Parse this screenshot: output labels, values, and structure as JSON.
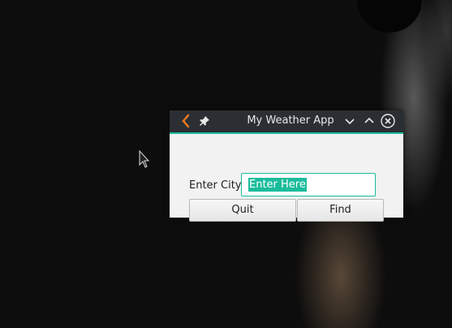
{
  "window": {
    "title": "My Weather App"
  },
  "form": {
    "city_label": "Enter City:",
    "city_value": "Enter Here"
  },
  "buttons": {
    "quit_label": "Quit",
    "find_label": "Find"
  },
  "titlebar_icons": [
    "app-menu-icon",
    "pin-icon",
    "minimize-icon",
    "maximize-icon",
    "close-icon"
  ],
  "colors": {
    "accent": "#1abc9c",
    "titlebar": "#2b2f33",
    "window_bg": "#f2f2f2",
    "app_icon": "#f47b20"
  }
}
